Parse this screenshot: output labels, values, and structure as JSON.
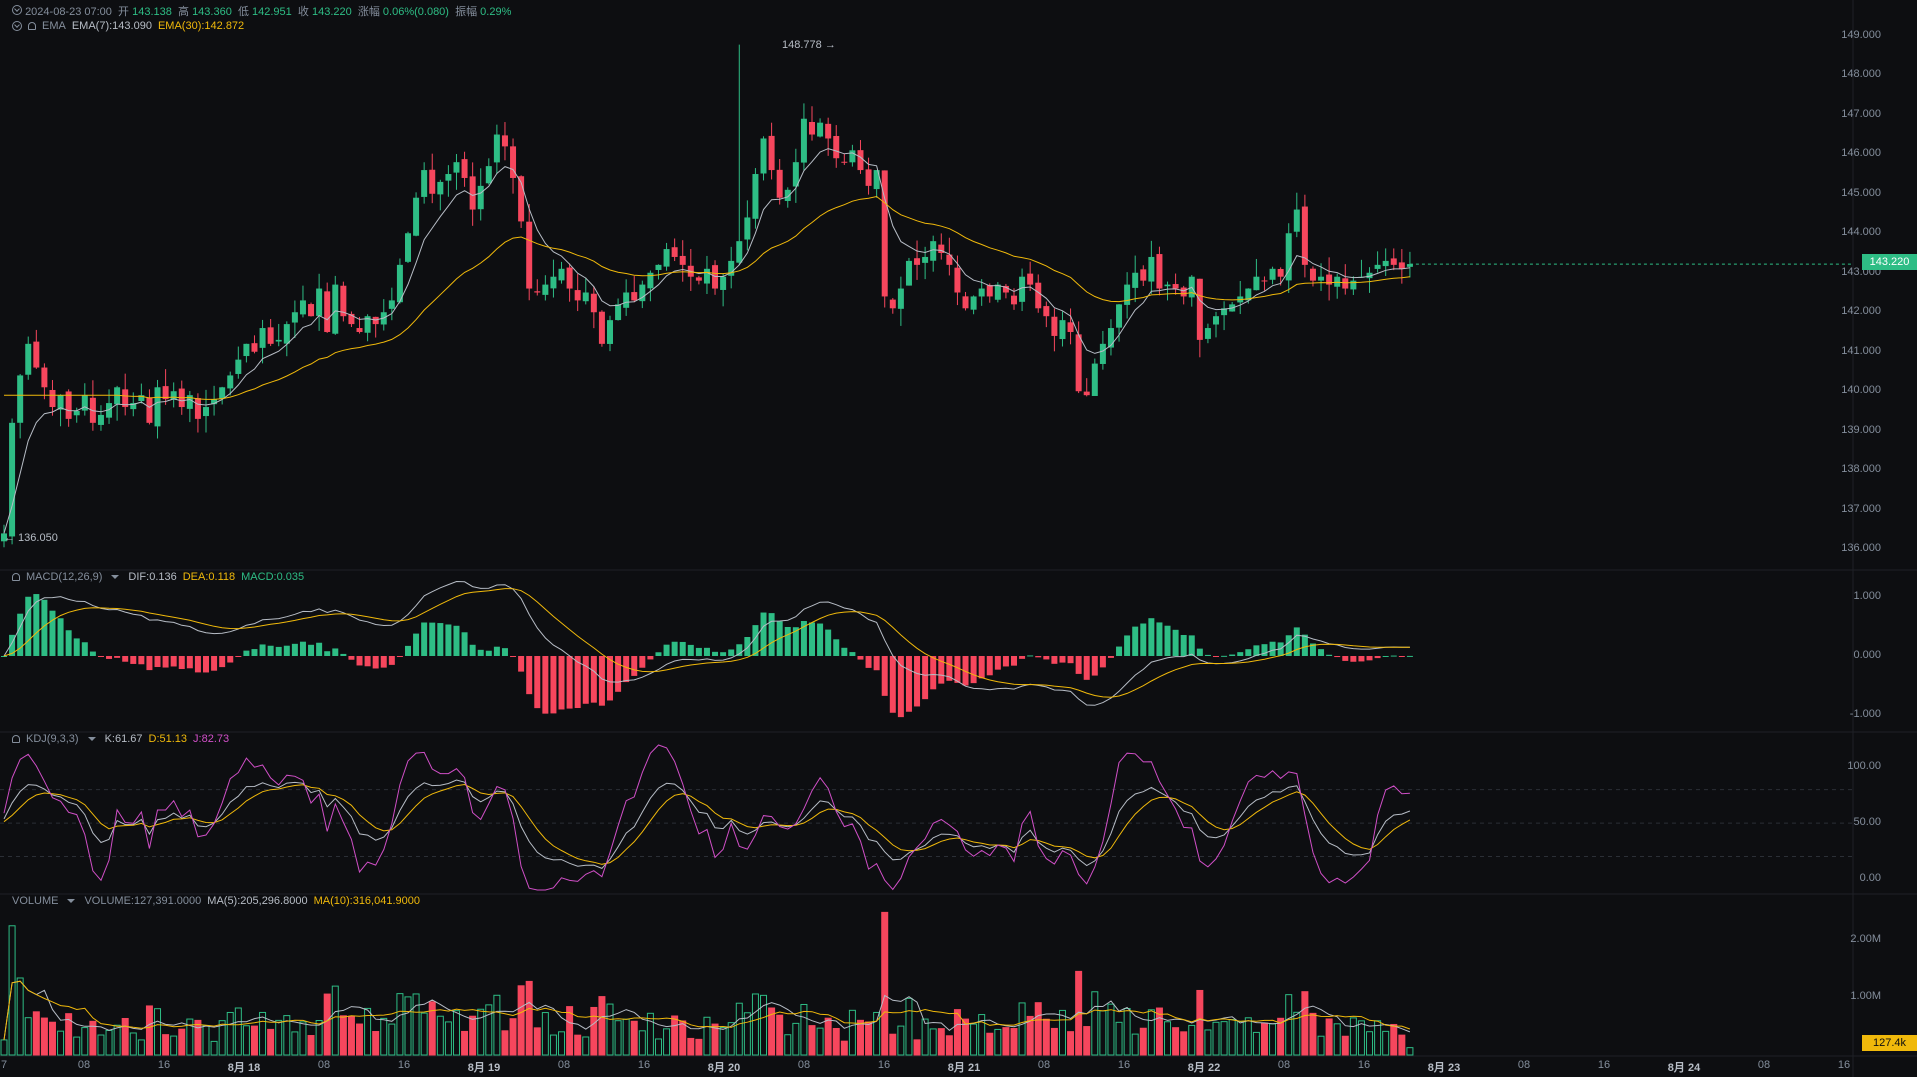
{
  "header": {
    "datetime": "2024-08-23 07:00",
    "open_label": "开",
    "open": "143.138",
    "high_label": "高",
    "high": "143.360",
    "low_label": "低",
    "low": "142.951",
    "close_label": "收",
    "close": "143.220",
    "change_label": "涨幅",
    "change": "0.06%(0.080)",
    "amp_label": "振幅",
    "amp": "0.29%"
  },
  "ema": {
    "label": "EMA",
    "ema7": "EMA(7):143.090",
    "ema30": "EMA(30):142.872"
  },
  "macd": {
    "label": "MACD(12,26,9)",
    "dif": "DIF:0.136",
    "dea": "DEA:0.118",
    "macd": "MACD:0.035"
  },
  "kdj": {
    "label": "KDJ(9,3,3)",
    "k": "K:61.67",
    "d": "D:51.13",
    "j": "J:82.73"
  },
  "volume": {
    "label": "VOLUME",
    "value": "VOLUME:127,391.0000",
    "ma5": "MA(5):205,296.8000",
    "ma10": "MA(10):316,041.9000"
  },
  "price_axis": [
    "149.000",
    "148.000",
    "147.000",
    "146.000",
    "145.000",
    "144.000",
    "143.000",
    "142.000",
    "141.000",
    "140.000",
    "139.000",
    "138.000",
    "137.000",
    "136.000"
  ],
  "macd_axis": [
    "1.000",
    "0.000",
    "-1.000"
  ],
  "kdj_axis": [
    "100.00",
    "50.00",
    "0.00"
  ],
  "volume_axis": [
    "2.00M",
    "1.00M"
  ],
  "current_price": "143.220",
  "current_volume": "127.4k",
  "high_marker": "148.778 →",
  "low_marker": "← 136.050",
  "time_axis": [
    "7",
    "08",
    "16",
    "8月 18",
    "08",
    "16",
    "8月 19",
    "08",
    "16",
    "8月 20",
    "08",
    "16",
    "8月 21",
    "08",
    "16",
    "8月 22",
    "08",
    "16",
    "8月 23",
    "08",
    "16",
    "8月 24",
    "08",
    "16"
  ],
  "colors": {
    "up": "#2ebd85",
    "down": "#f6465d",
    "ema7": "#b7bdc6",
    "ema30": "#f0b90b",
    "j": "#d04fc7",
    "bg": "#0d0e11"
  },
  "chart_data": {
    "type": "candlestick",
    "interval": "1h",
    "price_range": [
      135.6,
      149.4
    ],
    "high": 148.778,
    "low": 136.05,
    "closes": [
      136.4,
      139.2,
      140.4,
      141.2,
      140.6,
      140.1,
      139.6,
      139.9,
      139.3,
      139.5,
      139.9,
      139.2,
      139.4,
      139.7,
      140.1,
      139.6,
      139.7,
      139.9,
      139.2,
      140.1,
      139.8,
      140.0,
      139.6,
      139.9,
      139.3,
      139.6,
      139.8,
      140.1,
      140.4,
      140.8,
      141.2,
      141.0,
      141.6,
      141.2,
      141.3,
      141.7,
      142.0,
      142.3,
      141.9,
      142.6,
      141.5,
      142.7,
      141.9,
      141.7,
      141.5,
      141.9,
      141.7,
      142.0,
      142.3,
      143.2,
      144.0,
      144.9,
      145.6,
      145.0,
      145.3,
      145.5,
      145.8,
      145.4,
      144.6,
      145.2,
      145.7,
      146.5,
      146.2,
      145.4,
      144.3,
      142.6,
      142.5,
      142.7,
      142.9,
      143.1,
      142.6,
      142.3,
      142.5,
      142.0,
      141.2,
      141.8,
      142.2,
      142.5,
      142.3,
      142.7,
      143.0,
      143.2,
      143.6,
      143.4,
      143.2,
      142.9,
      142.8,
      143.1,
      142.6,
      142.9,
      143.3,
      143.8,
      144.4,
      145.5,
      146.4,
      145.6,
      144.9,
      145.1,
      145.8,
      146.9,
      146.5,
      146.8,
      146.4,
      145.9,
      145.8,
      146.1,
      145.6,
      145.2,
      145.6,
      142.4,
      142.1,
      142.6,
      143.3,
      143.2,
      143.4,
      143.8,
      143.5,
      143.2,
      142.5,
      142.1,
      142.4,
      142.6,
      142.4,
      142.7,
      142.5,
      142.2,
      142.9,
      142.7,
      142.1,
      141.9,
      141.4,
      141.8,
      141.5,
      140.0,
      139.9,
      140.7,
      141.2,
      141.6,
      142.2,
      142.7,
      143.0,
      142.8,
      143.4,
      142.6,
      142.7,
      142.6,
      142.4,
      142.9,
      141.3,
      141.6,
      141.9,
      142.1,
      142.2,
      142.4,
      142.6,
      142.9,
      142.8,
      143.1,
      142.9,
      144.0,
      144.6,
      143.2,
      142.8,
      142.9,
      142.7,
      142.9,
      142.6,
      142.8,
      142.9,
      143.0,
      143.2,
      143.3,
      143.2,
      143.1,
      143.22
    ],
    "ema7_last": 143.09,
    "ema30_last": 142.872,
    "macd": {
      "dif": 0.136,
      "dea": 0.118,
      "hist": 0.035,
      "range": [
        -1.2,
        1.2
      ]
    },
    "kdj": {
      "k": 61.67,
      "d": 51.13,
      "j": 82.73,
      "range": [
        -10,
        120
      ],
      "levels": [
        20,
        50,
        80
      ]
    },
    "volume": {
      "last": 127391,
      "ma5": 205296.8,
      "ma10": 316041.9,
      "range": [
        0,
        2600000
      ]
    }
  }
}
